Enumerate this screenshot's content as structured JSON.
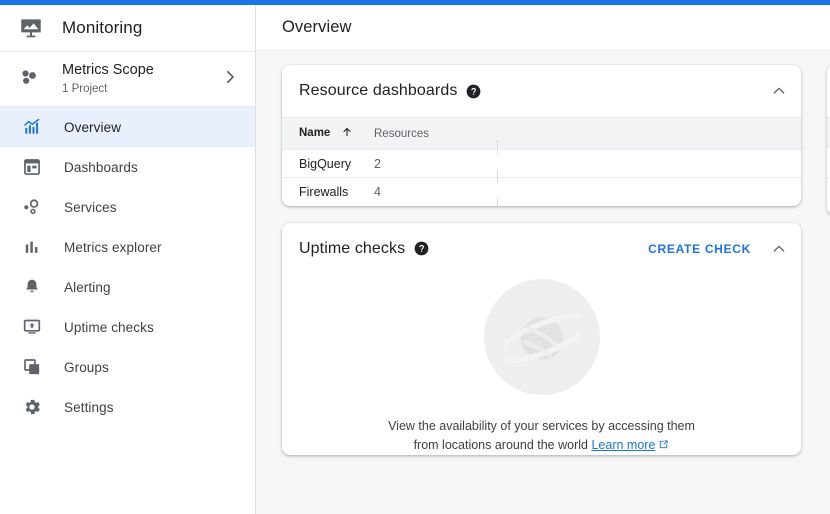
{
  "theme": {
    "accent": "#1a73e8",
    "active_nav_bg": "#e8f0fe",
    "canvas_bg": "#f7f7f7",
    "table_header_bg": "#f1f3f4",
    "text_primary": "#202124",
    "text_secondary": "#5f6368"
  },
  "sidebar": {
    "product": {
      "name": "Monitoring",
      "icon": "monitoring-icon"
    },
    "scope": {
      "title": "Metrics Scope",
      "subtitle": "1 Project",
      "icon": "metrics-scope-icon",
      "chevron": "chevron-right-icon"
    },
    "items": [
      {
        "label": "Overview",
        "icon": "overview-chart-icon",
        "active": true
      },
      {
        "label": "Dashboards",
        "icon": "dashboards-grid-icon",
        "active": false
      },
      {
        "label": "Services",
        "icon": "services-nodes-icon",
        "active": false
      },
      {
        "label": "Metrics explorer",
        "icon": "bar-chart-icon",
        "active": false
      },
      {
        "label": "Alerting",
        "icon": "bell-icon",
        "active": false
      },
      {
        "label": "Uptime checks",
        "icon": "uptime-monitor-icon",
        "active": false
      },
      {
        "label": "Groups",
        "icon": "groups-copy-icon",
        "active": false
      },
      {
        "label": "Settings",
        "icon": "gear-icon",
        "active": false
      }
    ]
  },
  "header": {
    "title": "Overview"
  },
  "cards": {
    "resource_dashboards": {
      "title": "Resource dashboards",
      "help_icon": "help-circle-icon",
      "collapse_icon": "chevron-up-icon",
      "table": {
        "columns": [
          "Name",
          "Resources"
        ],
        "sort_column": "Name",
        "sort_direction": "ascending",
        "sort_icon": "arrow-up-icon",
        "rows": [
          {
            "name": "BigQuery",
            "resources": "2"
          },
          {
            "name": "Firewalls",
            "resources": "4"
          }
        ]
      }
    },
    "uptime_checks": {
      "title": "Uptime checks",
      "help_icon": "help-circle-icon",
      "action_label": "CREATE CHECK",
      "collapse_icon": "chevron-up-icon",
      "empty_state": {
        "illustration": "planet-globe-icon",
        "line1": "View the availability of your services by accessing them",
        "line2": "from locations around the world",
        "link_label": "Learn more",
        "link_icon": "external-link-icon"
      }
    }
  }
}
